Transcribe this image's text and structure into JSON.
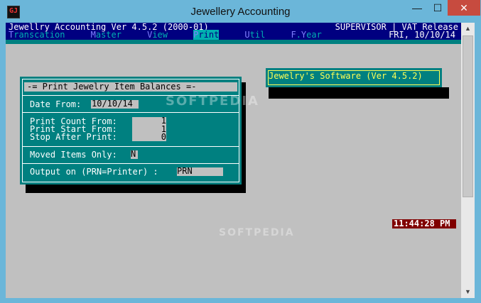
{
  "window": {
    "title": "Jewellery Accounting",
    "icon": "app-icon",
    "icon_glyph": "GJ",
    "controls": {
      "minimize": "—",
      "maximize": "☐",
      "close": "✕"
    }
  },
  "header": {
    "app_name": "Jewellry Accounting Ver 4.5.2 (2000-01)",
    "role_info": "SUPERVISOR | VAT Release",
    "date": "FRI, 10/10/14"
  },
  "menu": [
    {
      "hot": "T",
      "rest": "ranscation",
      "selected": false
    },
    {
      "hot": "M",
      "rest": "aster",
      "selected": false
    },
    {
      "hot": "V",
      "rest": "iew",
      "selected": false
    },
    {
      "hot": "P",
      "rest": "rint",
      "selected": true
    },
    {
      "hot": "U",
      "rest": "til",
      "selected": false
    },
    {
      "hot": "F",
      "rest": ".",
      "hot2": "Y",
      "rest2": "ear",
      "selected": false
    }
  ],
  "software_banner": "Jewelry's Software (Ver 4.5.2)",
  "dialog": {
    "title": "-= Print Jewelry Item Balances =-",
    "date_from_label": "Date From:",
    "date_from_value": "10/10/14",
    "print_count_label": "Print Count From:",
    "print_count_value": "1",
    "print_start_label": "Print Start From:",
    "print_start_value": "1",
    "stop_after_label": "Stop After Print:",
    "stop_after_value": "0",
    "moved_items_label": "Moved Items Only:",
    "moved_items_value": "N",
    "output_label": "Output on (PRN=Printer) :",
    "output_value": "PRN"
  },
  "clock": "11:44:28 PM",
  "watermark": "SOFTPEDIA",
  "watermark2": "SOFTPEDIA",
  "colors": {
    "console_bg": "#c0c0c0",
    "navy": "#000080",
    "teal": "#008080",
    "clock_bg": "#800000",
    "banner_text": "#ffff55"
  }
}
